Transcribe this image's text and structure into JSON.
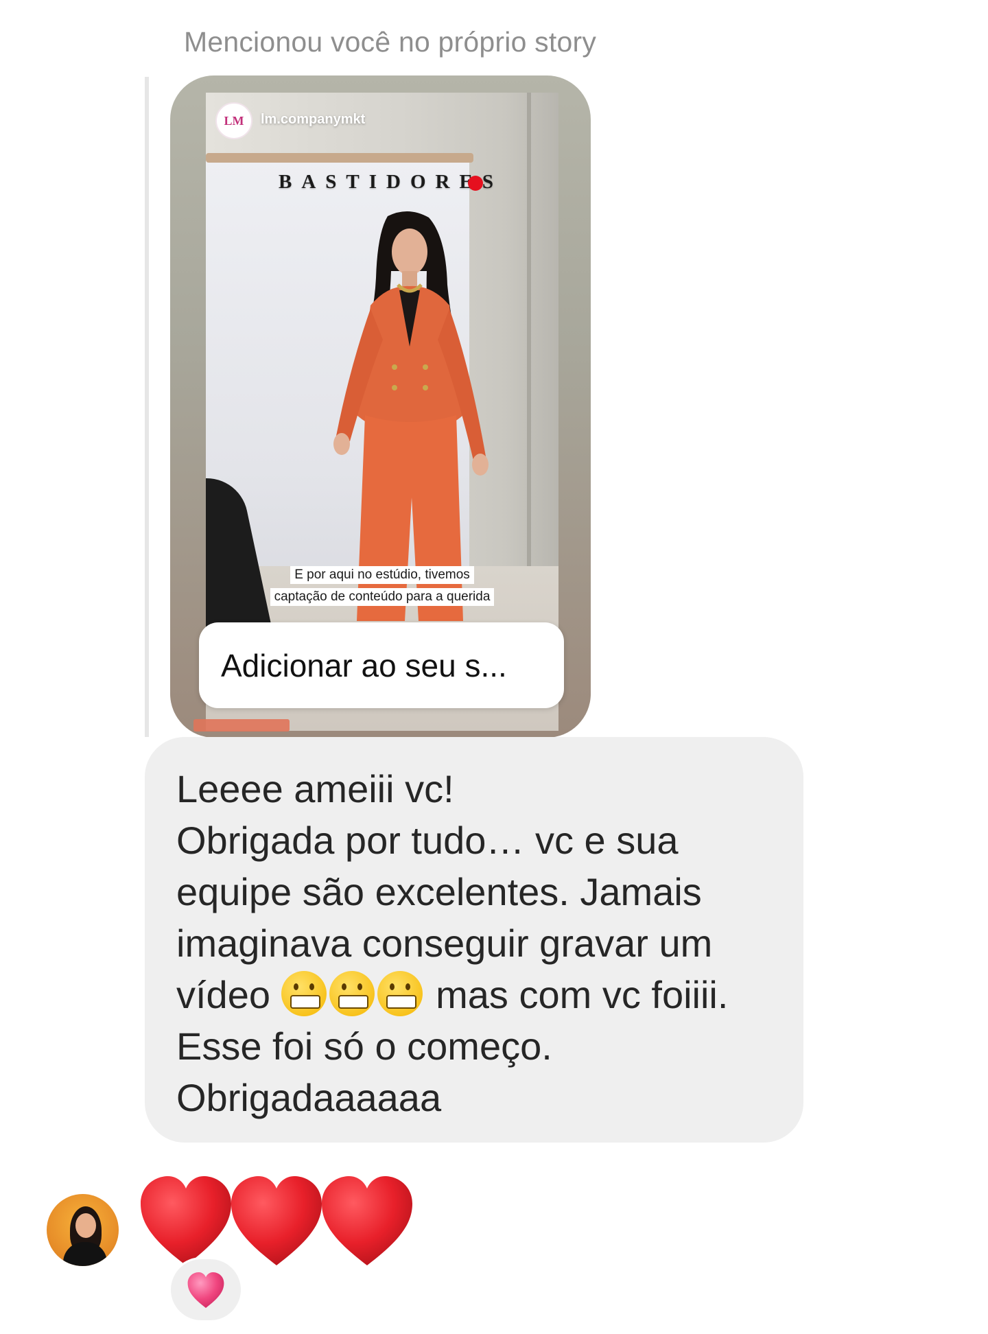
{
  "mention_label": "Mencionou você no próprio story",
  "story": {
    "username": "lm.companymkt",
    "avatar_text": "LM",
    "title": "BASTIDORES",
    "caption_lines": [
      "E por aqui no estúdio, tivemos",
      "captação de conteúdo para a querida"
    ],
    "add_to_story_label": "Adicionar ao seu s...",
    "accent_color": "#e5101e"
  },
  "message": {
    "lines": [
      "Leeee ameiii vc!",
      "Obrigada por tudo… vc e sua",
      "equipe são excelentes. Jamais",
      "imaginava conseguir gravar um",
      "vídeo",
      "mas com vc foiiii.",
      "Esse foi só o começo.",
      "Obrigadaaaaaa"
    ],
    "bubble_color": "#efefef"
  },
  "reply": {
    "content": "heart-emoji x3",
    "heart_color": "#e8202a"
  },
  "reaction": {
    "icon": "pink-heart-icon",
    "color": "#f0467f"
  }
}
